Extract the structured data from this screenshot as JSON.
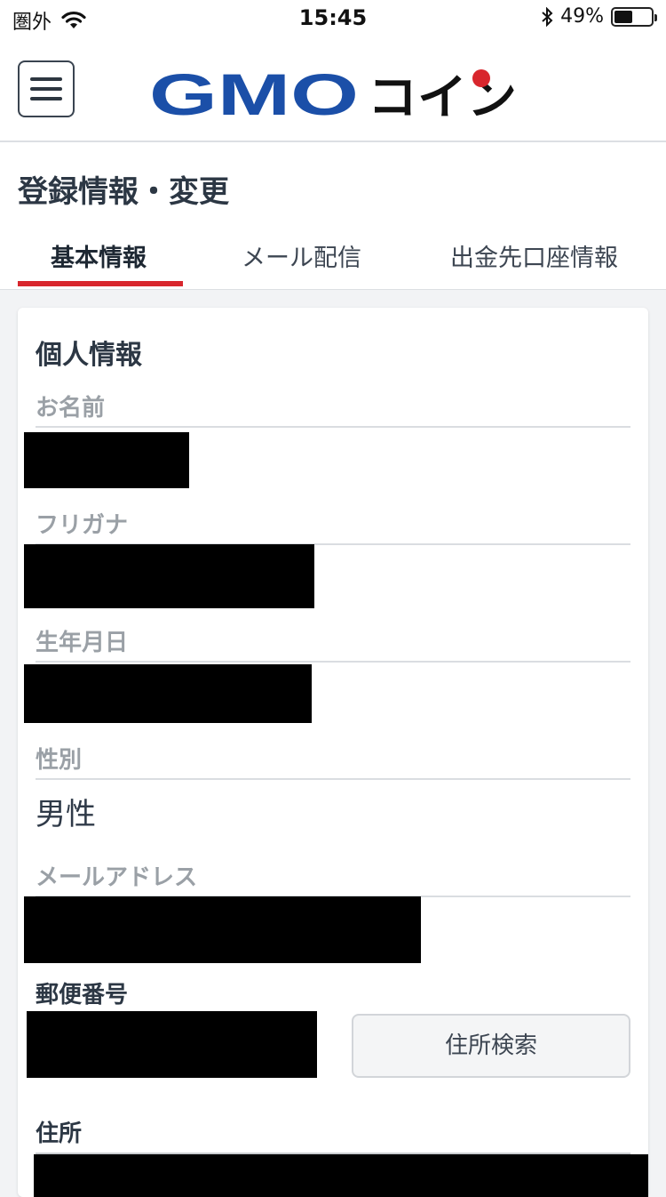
{
  "status_bar": {
    "carrier": "圏外",
    "time": "15:45",
    "battery_percent_text": "49%",
    "battery_level": 0.49
  },
  "header": {
    "logo_text_latin": "GMO",
    "logo_text_kana": "コイン",
    "brand_colors": {
      "blue": "#1b4fa8",
      "red": "#d8262d",
      "black": "#111111"
    }
  },
  "page": {
    "title": "登録情報・変更",
    "tabs": [
      {
        "label": "基本情報",
        "active": true
      },
      {
        "label": "メール配信",
        "active": false
      },
      {
        "label": "出金先口座情報",
        "active": false
      }
    ]
  },
  "personal_info": {
    "section_title": "個人情報",
    "fields": {
      "name": {
        "label": "お名前"
      },
      "furigana": {
        "label": "フリガナ"
      },
      "birthdate": {
        "label": "生年月日"
      },
      "gender": {
        "label": "性別",
        "value": "男性"
      },
      "email": {
        "label": "メールアドレス"
      }
    },
    "postal_code": {
      "label": "郵便番号",
      "search_button": "住所検索"
    },
    "address": {
      "label": "住所"
    }
  }
}
